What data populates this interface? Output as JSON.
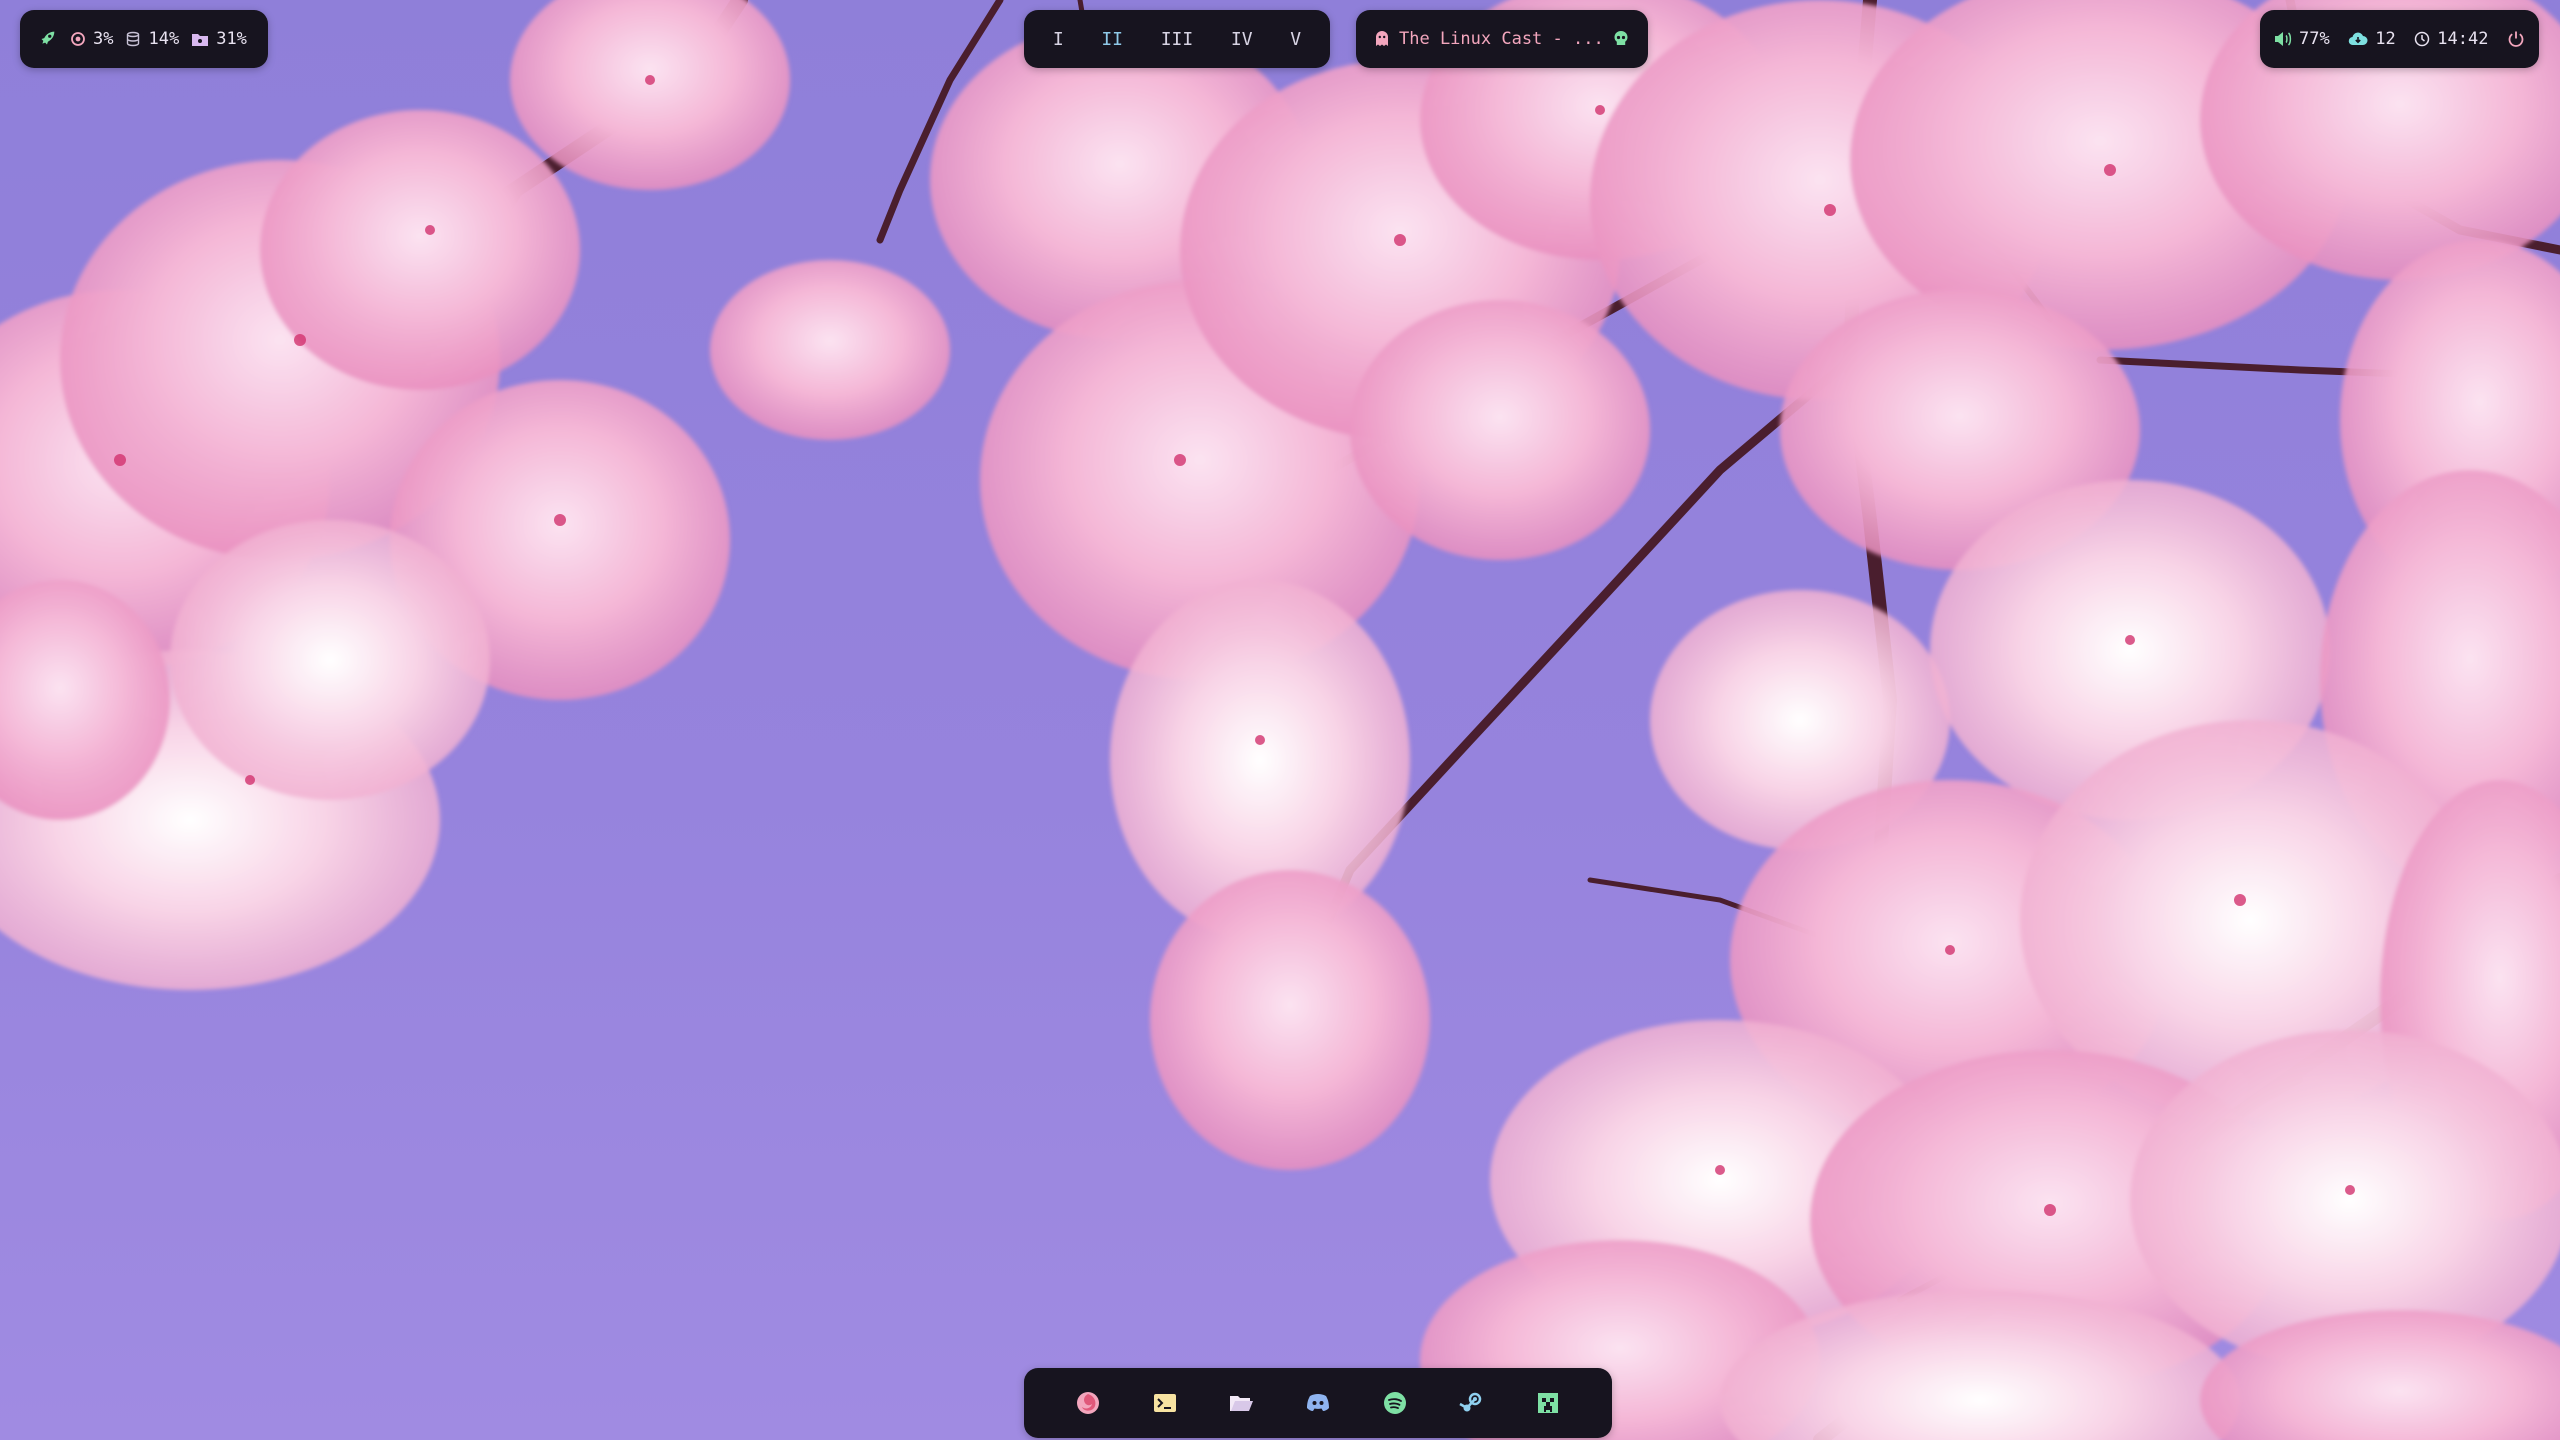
{
  "colors": {
    "bar_bg": "#17141f",
    "sky": "#9683dd",
    "blossom": "#f5b8d6",
    "accent_green": "#7ee0a4",
    "accent_pink": "#f3a6bd",
    "accent_blue": "#8fc9e8"
  },
  "sysmon": {
    "launcher_icon": "rocket-icon",
    "cpu": {
      "icon": "cpu-icon",
      "value": "3%"
    },
    "memory": {
      "icon": "database-icon",
      "value": "14%"
    },
    "disk": {
      "icon": "folder-icon",
      "value": "31%"
    }
  },
  "workspaces": [
    "I",
    "II",
    "III",
    "IV",
    "V"
  ],
  "media": {
    "left_icon": "spotify-ghost-icon",
    "title": "The Linux Cast - ...",
    "right_icon": "skull-icon"
  },
  "status": {
    "volume": {
      "icon": "volume-icon",
      "value": "77%"
    },
    "updates": {
      "icon": "cloud-download-icon",
      "value": "12"
    },
    "clock": {
      "icon": "clock-icon",
      "value": "14:42"
    },
    "power_icon": "power-icon"
  },
  "dock": [
    {
      "name": "firefox",
      "icon": "firefox-icon"
    },
    {
      "name": "terminal",
      "icon": "terminal-icon"
    },
    {
      "name": "files",
      "icon": "folder-open-icon"
    },
    {
      "name": "discord",
      "icon": "discord-icon"
    },
    {
      "name": "spotify",
      "icon": "spotify-icon"
    },
    {
      "name": "steam",
      "icon": "steam-icon"
    },
    {
      "name": "minecraft",
      "icon": "minecraft-icon"
    }
  ]
}
